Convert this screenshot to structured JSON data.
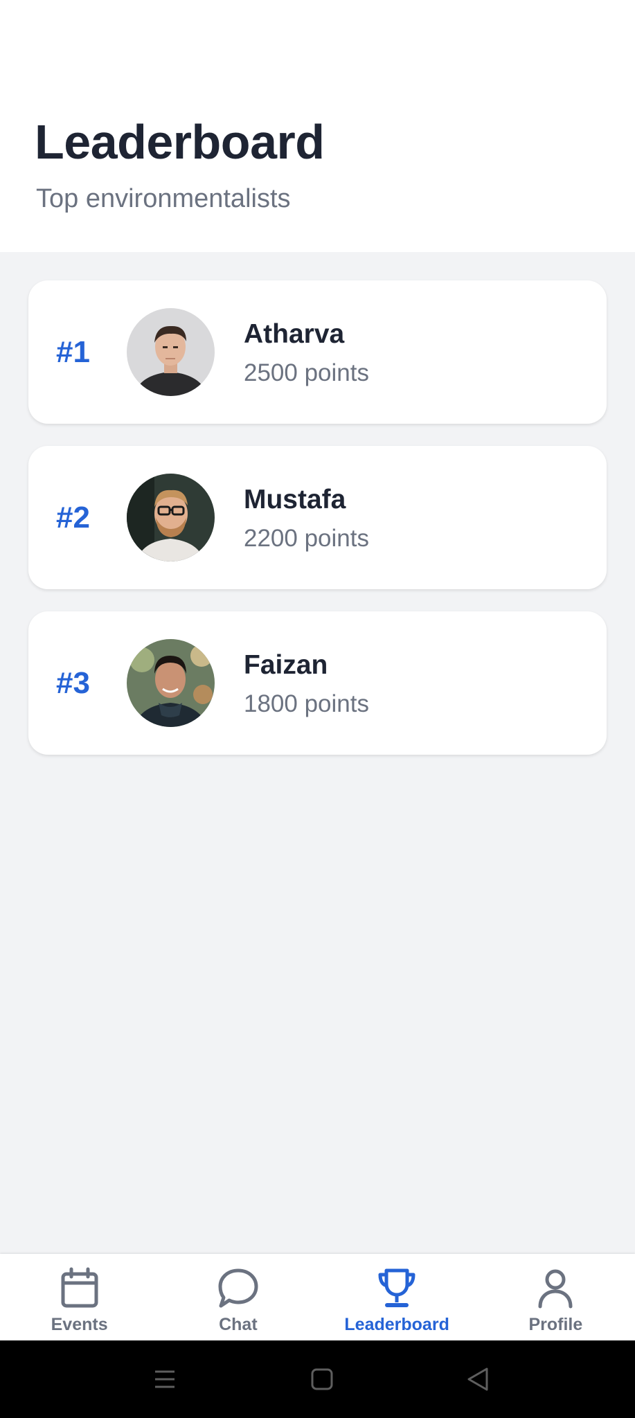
{
  "header": {
    "title": "Leaderboard",
    "subtitle": "Top environmentalists"
  },
  "leaders": [
    {
      "rank": "#1",
      "name": "Atharva",
      "points": "2500 points",
      "avatar": "avatar-photo"
    },
    {
      "rank": "#2",
      "name": "Mustafa",
      "points": "2200 points",
      "avatar": "avatar-photo"
    },
    {
      "rank": "#3",
      "name": "Faizan",
      "points": "1800 points",
      "avatar": "avatar-photo"
    }
  ],
  "nav": {
    "items": [
      {
        "label": "Events",
        "icon": "calendar-icon"
      },
      {
        "label": "Chat",
        "icon": "chat-bubble-icon"
      },
      {
        "label": "Leaderboard",
        "icon": "trophy-icon",
        "active": true
      },
      {
        "label": "Profile",
        "icon": "person-icon"
      }
    ]
  },
  "system_nav": [
    "menu-icon",
    "home-square-icon",
    "back-triangle-icon"
  ],
  "colors": {
    "accent": "#2563d6",
    "text_primary": "#1e2433",
    "text_secondary": "#6b7280",
    "background": "#f2f3f5",
    "card": "#ffffff"
  }
}
